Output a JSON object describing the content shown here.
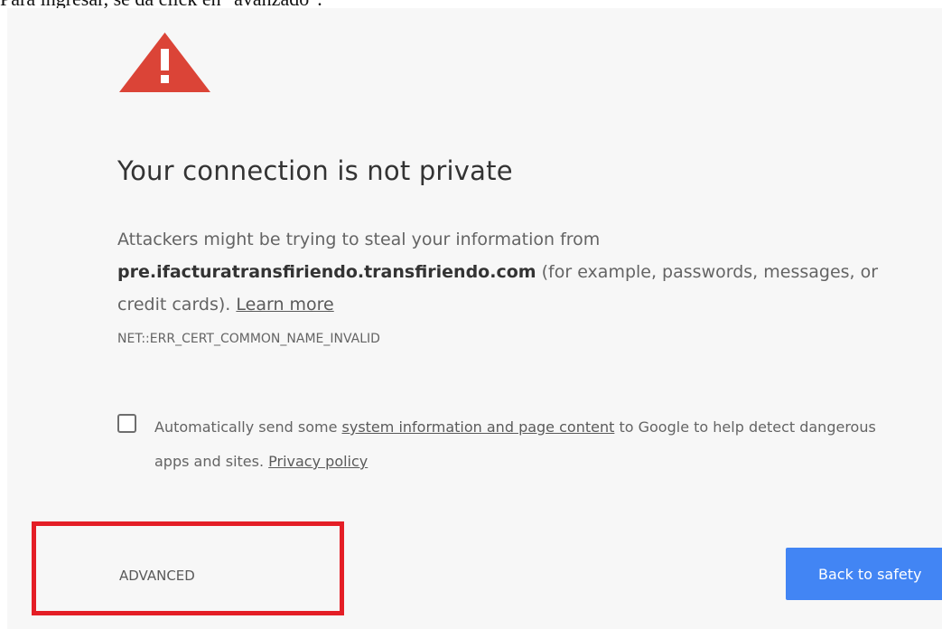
{
  "caption": {
    "text": "Para ingresar, se da click en \"avanzado\"."
  },
  "interstitial": {
    "title": "Your connection is not private",
    "body_prefix": "Attackers might be trying to steal your information from",
    "host": "pre.ifacturatransfiriendo.transfiriendo.com",
    "body_suffix": "(for example, passwords, messages, or credit cards).",
    "learn_more_label": "Learn more",
    "error_code": "NET::ERR_CERT_COMMON_NAME_INVALID",
    "checkbox": {
      "checked": false,
      "text_before": "Automatically send some",
      "link_label": "system information and page content",
      "text_after": "to Google to help detect dangerous apps and sites.",
      "privacy_label": "Privacy policy"
    },
    "advanced_label": "ADVANCED",
    "back_label": "Back to safety"
  },
  "colors": {
    "warning_red": "#db4437",
    "button_blue": "#4285f4",
    "highlight_red": "#e41e26",
    "page_background": "#f7f7f7"
  },
  "icons": {
    "warning": "warning-triangle-icon"
  }
}
